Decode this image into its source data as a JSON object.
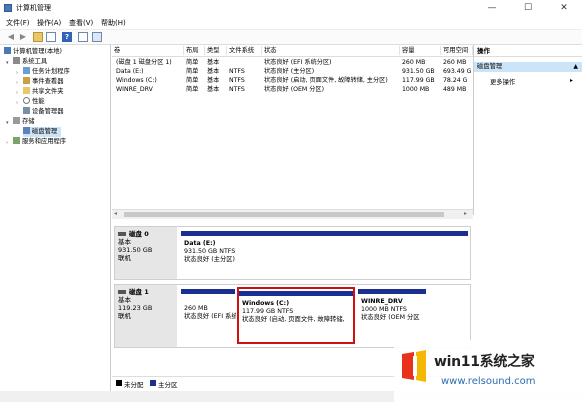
{
  "window": {
    "title": "计算机管理",
    "min": "—",
    "max": "☐",
    "close": "✕"
  },
  "menu": [
    "文件(F)",
    "操作(A)",
    "查看(V)",
    "帮助(H)"
  ],
  "tree": {
    "root": "计算机管理(本地)",
    "system_tools": "系统工具",
    "task_scheduler": "任务计划程序",
    "event_viewer": "事件查看器",
    "shared_folders": "共享文件夹",
    "performance": "性能",
    "device_manager": "设备管理器",
    "storage": "存储",
    "disk_management": "磁盘管理",
    "services": "服务和应用程序"
  },
  "volumes": {
    "columns": [
      "卷",
      "布局",
      "类型",
      "文件系统",
      "状态",
      "容量",
      "可用空间"
    ],
    "rows": [
      [
        "(磁盘 1 磁盘分区 1)",
        "简单",
        "基本",
        "",
        "状态良好 (EFI 系统分区)",
        "260 MB",
        "260 MB"
      ],
      [
        "Data (E:)",
        "简单",
        "基本",
        "NTFS",
        "状态良好 (主分区)",
        "931.50 GB",
        "693.49 G"
      ],
      [
        "Windows (C:)",
        "简单",
        "基本",
        "NTFS",
        "状态良好 (启动, 页面文件, 故障转储, 主分区)",
        "117.99 GB",
        "78.24 G"
      ],
      [
        "WINRE_DRV",
        "简单",
        "基本",
        "NTFS",
        "状态良好 (OEM 分区)",
        "1000 MB",
        "489 MB"
      ]
    ]
  },
  "disks": [
    {
      "name": "磁盘 0",
      "type": "基本",
      "size": "931.50 GB",
      "status": "联机",
      "partitions": [
        {
          "name": "Data  (E:)",
          "size": "931.50 GB NTFS",
          "status": "状态良好 (主分区)"
        }
      ]
    },
    {
      "name": "磁盘 1",
      "type": "基本",
      "size": "119.23 GB",
      "status": "联机",
      "partitions": [
        {
          "name": "",
          "size": "260 MB",
          "status": "状态良好 (EFI 系统分区"
        },
        {
          "name": "Windows  (C:)",
          "size": "117.99 GB NTFS",
          "status": "状态良好 (启动, 页面文件, 故障转储,"
        },
        {
          "name": "WINRE_DRV",
          "size": "1000 MB NTFS",
          "status": "状态良好 (OEM 分区"
        }
      ]
    }
  ],
  "legend": {
    "unallocated": "未分配",
    "primary": "主分区"
  },
  "actions": {
    "header": "操作",
    "section": "磁盘管理",
    "more": "更多操作"
  },
  "watermark": {
    "brand": "win11系统之家",
    "url": "www.relsound.com"
  },
  "colors": {
    "primary_bar": "#1a2f8f",
    "unallocated": "#000000",
    "selection": "#cce4f7",
    "highlight": "#d01010",
    "logo_red": "#e8321c",
    "logo_yellow": "#f5b800"
  }
}
